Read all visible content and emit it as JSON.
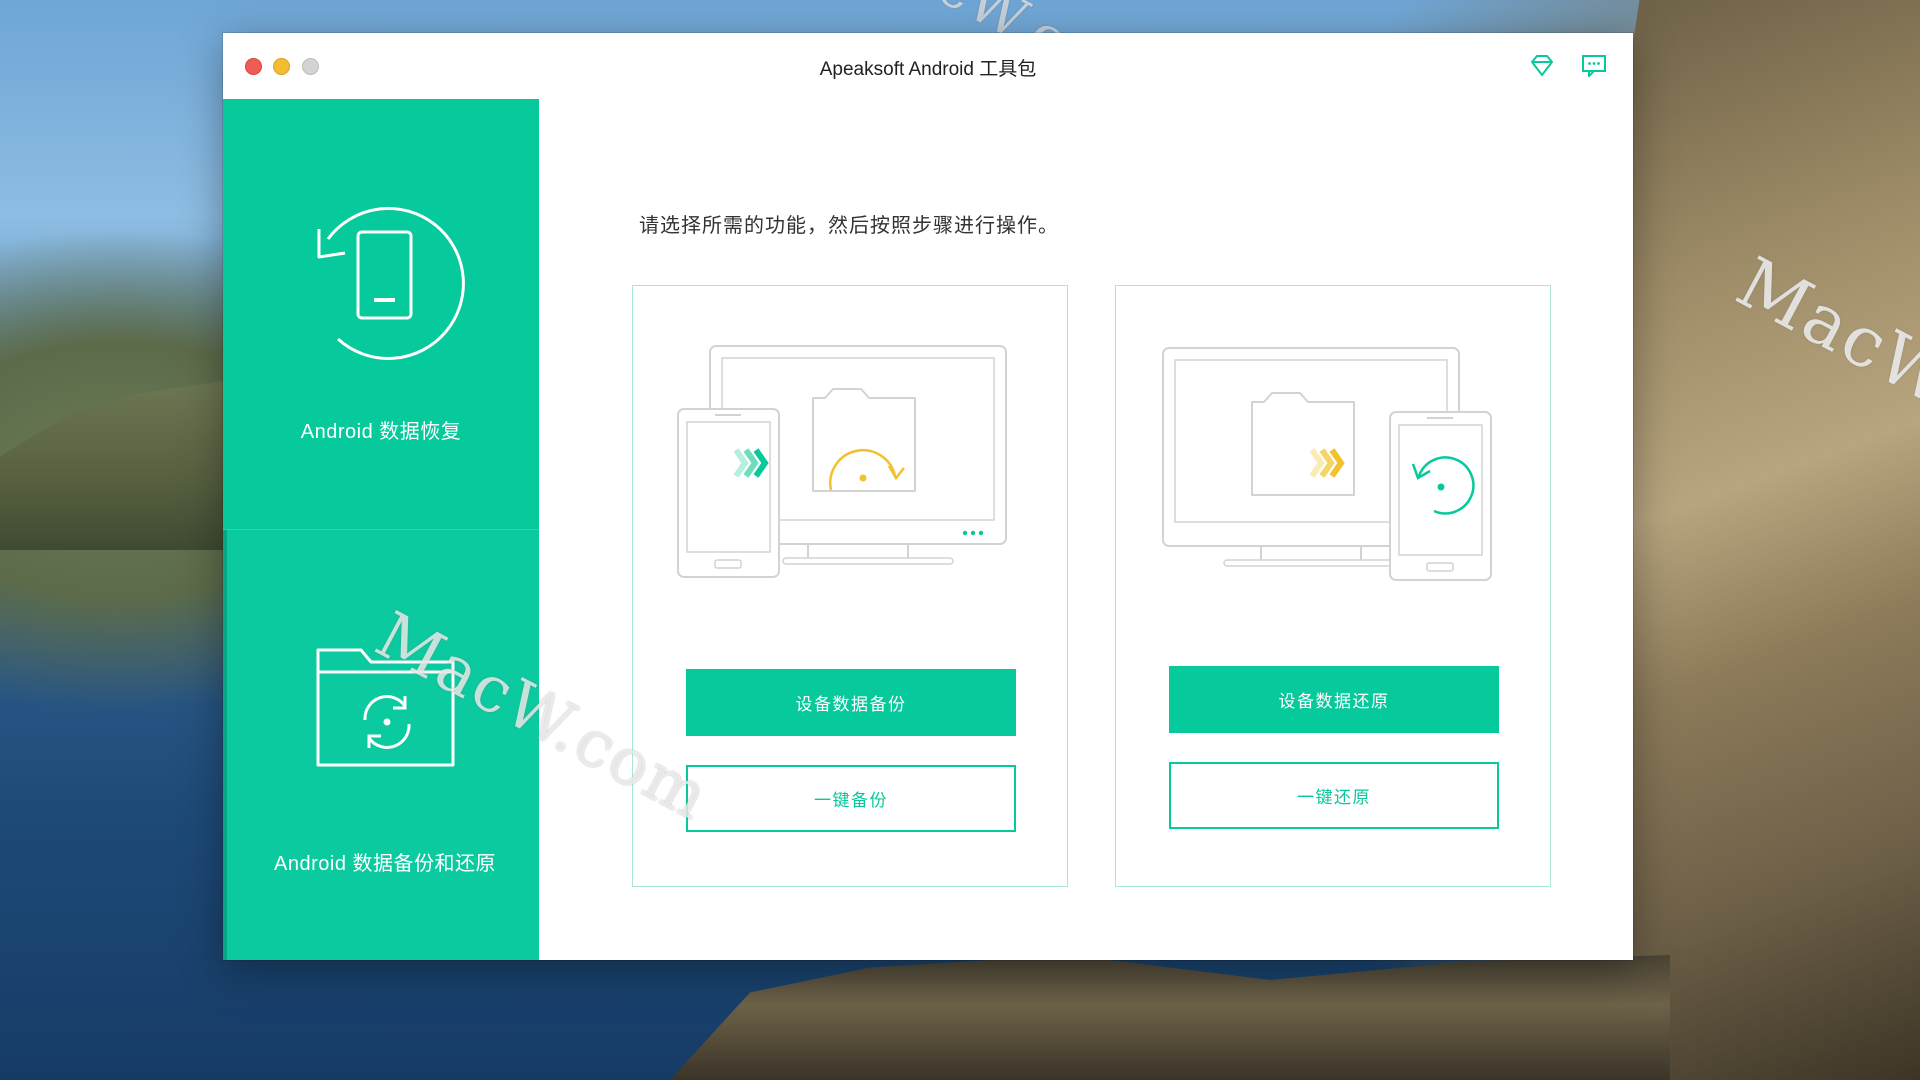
{
  "desktop": {
    "watermark_text": "MacW.com"
  },
  "window": {
    "title": "Apeaksoft Android 工具包",
    "titlebar_icons": [
      "diamond-icon",
      "chat-icon"
    ]
  },
  "sidebar": {
    "items": [
      {
        "label": "Android 数据恢复",
        "icon": "phone-restore-icon"
      },
      {
        "label": "Android 数据备份和还原",
        "icon": "folder-sync-icon"
      }
    ]
  },
  "main": {
    "instruction": "请选择所需的功能，然后按照步骤进行操作。",
    "cards": [
      {
        "illustration": "phone-to-computer-backup",
        "primary_label": "设备数据备份",
        "secondary_label": "一键备份"
      },
      {
        "illustration": "computer-to-phone-restore",
        "primary_label": "设备数据还原",
        "secondary_label": "一键还原"
      }
    ]
  },
  "colors": {
    "accent": "#06c99c",
    "card_border": "#a9e8d8",
    "arrow_yellow": "#f2c12e"
  }
}
